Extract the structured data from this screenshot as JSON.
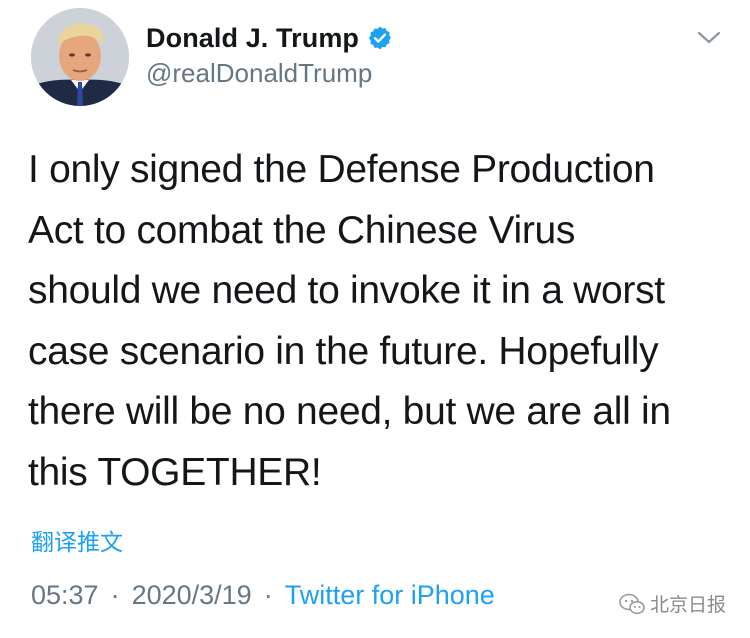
{
  "author": {
    "display_name": "Donald J. Trump",
    "handle": "@realDonaldTrump",
    "verified": true
  },
  "tweet": {
    "text": "I only signed the Defense Production\nAct to combat the Chinese Virus\nshould we need to invoke it in a worst\ncase scenario in the future. Hopefully\nthere will be no need, but we are all in\nthis TOGETHER!",
    "translate_label": "翻译推文",
    "time": "05:37",
    "date": "2020/3/19",
    "separator": "·",
    "source": "Twitter for iPhone"
  },
  "watermark": {
    "label": "北京日报",
    "icon": "wechat-icon"
  },
  "colors": {
    "link_blue": "#1da1f2",
    "text_primary": "#14171a",
    "text_secondary": "#657786",
    "verified_blue": "#1da1f2"
  },
  "icons": {
    "menu": "chevron-down-icon",
    "badge": "verified-icon"
  }
}
